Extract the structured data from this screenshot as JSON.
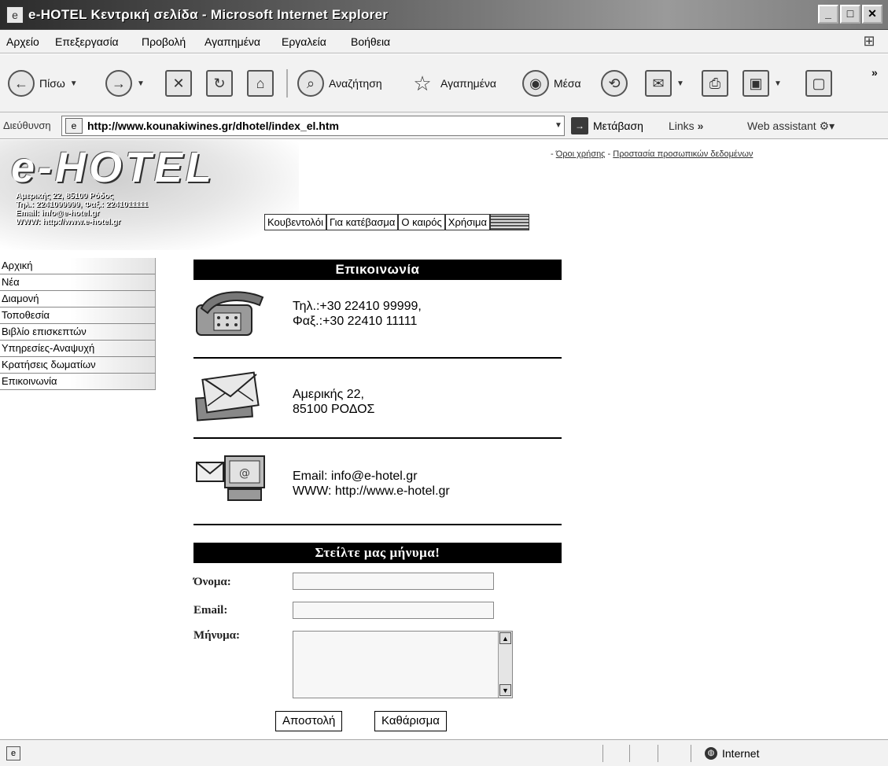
{
  "window": {
    "title": "e-HOTEL Κεντρική σελίδα - Microsoft Internet Explorer",
    "app_icon": "ie-page-icon",
    "controls": [
      "minimize",
      "maximize",
      "close"
    ]
  },
  "menubar": {
    "items": [
      "Αρχείο",
      "Επεξεργασία",
      "Προβολή",
      "Αγαπημένα",
      "Εργαλεία",
      "Βοήθεια"
    ]
  },
  "toolbar": {
    "back_label": "Πίσω",
    "search_label": "Αναζήτηση",
    "favorites_label": "Αγαπημένα",
    "media_label": "Μέσα"
  },
  "addressbar": {
    "label": "Διεύθυνση",
    "url": "http://www.kounakiwines.gr/dhotel/index_el.htm",
    "go_label": "Μετάβαση",
    "links_label": "Links",
    "assistant_label": "Web assistant"
  },
  "site": {
    "logo": "e-HOTEL",
    "logo_info": [
      "Αμερικής 22, 85100 Ρόδος",
      "Τηλ.: 2241099999, Φαξ.: 2241011111",
      "Email: info@e-hotel.gr",
      "WWW: http://www.e-hotel.gr"
    ],
    "top_links": [
      "Όροι χρήσης",
      "Προστασία προσωπικών δεδομένων"
    ],
    "nav_tabs": [
      "Κουβεντολόι",
      "Για κατέβασμα",
      "Ο καιρός",
      "Χρήσιμα"
    ],
    "left_menu": [
      "Αρχική",
      "Νέα",
      "Διαμονή",
      "Τοποθεσία",
      "Βιβλίο επισκεπτών",
      "Υπηρεσίες-Αναψυχή",
      "Κρατήσεις δωματίων",
      "Επικοινωνία"
    ]
  },
  "contact": {
    "header": "Επικοινωνία",
    "phone_line1": "Τηλ.:+30 22410 99999,",
    "phone_line2": "Φαξ.:+30 22410 11111",
    "address_line1": "Αμερικής 22,",
    "address_line2": "85100 ΡΟΔΟΣ",
    "email_line": "Email: info@e-hotel.gr",
    "www_line": "WWW: http://www.e-hotel.gr"
  },
  "form": {
    "header": "Στείλτε μας μήνυμα!",
    "name_label": "Όνομα:",
    "email_label": "Email:",
    "message_label": "Μήνυμα:",
    "submit_label": "Αποστολή",
    "reset_label": "Καθάρισμα",
    "name_value": "",
    "email_value": "",
    "message_value": ""
  },
  "statusbar": {
    "zone": "Internet"
  }
}
